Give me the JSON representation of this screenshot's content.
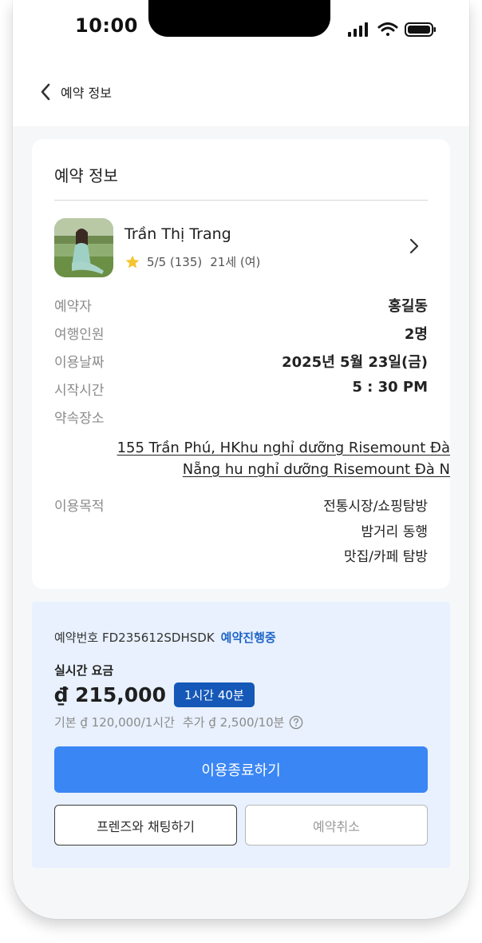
{
  "status_bar": {
    "time": "10:00",
    "icons": [
      "signal-icon",
      "wifi-icon",
      "battery-icon"
    ]
  },
  "nav": {
    "back_icon": "chevron-left-icon",
    "title": "예약 정보"
  },
  "reservation_card": {
    "title": "예약 정보",
    "profile": {
      "name": "Trần Thị Trang",
      "rating": "5/5 (135)",
      "age_gender": "21세 (여)",
      "icons": [
        "star-icon",
        "chevron-right-icon"
      ]
    },
    "details": [
      {
        "label": "예약자",
        "value": "홍길동"
      },
      {
        "label": "여행인원",
        "value": "2명"
      },
      {
        "label": "이용날짜",
        "value": "2025년 5월 23일(금)"
      },
      {
        "label": "시작시간",
        "value": "5 : 30 PM"
      },
      {
        "label": "약속장소",
        "value": ""
      }
    ],
    "address": [
      "155 Trần Phú, HKhu nghỉ dưỡng Risemount Đà",
      "Nẵng hu nghỉ dưỡng Risemount Đà N"
    ],
    "purpose_label": "이용목적",
    "purposes": [
      "전통시장/쇼핑탐방",
      "밤거리 동행",
      "맛집/카페 탐방"
    ]
  },
  "payment_card": {
    "reservation_no": "예약번호 FD235612SDHSDK",
    "status": "예약진행중",
    "realtime_label": "실시간 요금",
    "price": "₫ 215,000",
    "duration": "1시간 40분",
    "base_rate": "기본 ₫ 120,000/1시간",
    "extra_rate": "추가 ₫ 2,500/10분",
    "help_icon": "question-circle-icon",
    "end_button": "이용종료하기",
    "chat_button": "프렌즈와 채팅하기",
    "cancel_button": "예약취소"
  },
  "colors": {
    "primary": "#3a86f4",
    "badge": "#1558b8",
    "status_text": "#1f65c7",
    "card_bg": "#e8f1fd",
    "star": "#f5c430"
  }
}
